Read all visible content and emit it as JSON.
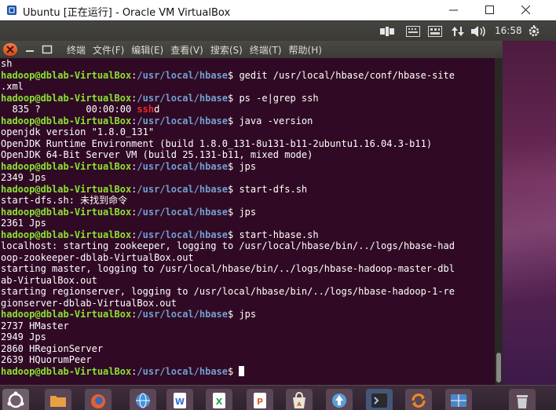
{
  "window": {
    "title": "Ubuntu [正在运行] - Oracle VM VirtualBox"
  },
  "panel": {
    "clock": "16:58",
    "icons": [
      "keyboard-layout-icon",
      "input-method-icon",
      "input-method-grid-icon",
      "network-updown-icon",
      "volume-icon",
      "settings-gear-icon"
    ]
  },
  "terminal": {
    "menu": [
      "终端",
      "文件(F)",
      "编辑(E)",
      "查看(V)",
      "搜索(S)",
      "终端(T)",
      "帮助(H)"
    ],
    "prompt_user": "hadoop@dblab-VirtualBox",
    "prompt_path": "/usr/local/hbase",
    "prompt_sep": ":",
    "prompt_end": "$ ",
    "lines": [
      {
        "t": "out",
        "text": "sh"
      },
      {
        "t": "prompt",
        "cmd": "gedit /usr/local/hbase/conf/hbase-site"
      },
      {
        "t": "out",
        "text": ".xml"
      },
      {
        "t": "prompt",
        "cmd": "ps -e|grep ssh"
      },
      {
        "t": "psline",
        "pre": "  835 ?        00:00:00 ",
        "hl": "ssh",
        "post": "d"
      },
      {
        "t": "prompt",
        "cmd": "java -version"
      },
      {
        "t": "out",
        "text": "openjdk version \"1.8.0_131\""
      },
      {
        "t": "out",
        "text": "OpenJDK Runtime Environment (build 1.8.0_131-8u131-b11-2ubuntu1.16.04.3-b11)"
      },
      {
        "t": "out",
        "text": "OpenJDK 64-Bit Server VM (build 25.131-b11, mixed mode)"
      },
      {
        "t": "prompt",
        "cmd": "jps"
      },
      {
        "t": "out",
        "text": "2349 Jps"
      },
      {
        "t": "prompt",
        "cmd": "start-dfs.sh"
      },
      {
        "t": "out",
        "text": "start-dfs.sh: 未找到命令"
      },
      {
        "t": "prompt",
        "cmd": "jps"
      },
      {
        "t": "out",
        "text": "2361 Jps"
      },
      {
        "t": "prompt",
        "cmd": "start-hbase.sh"
      },
      {
        "t": "out",
        "text": "localhost: starting zookeeper, logging to /usr/local/hbase/bin/../logs/hbase-had"
      },
      {
        "t": "out",
        "text": "oop-zookeeper-dblab-VirtualBox.out"
      },
      {
        "t": "out",
        "text": "starting master, logging to /usr/local/hbase/bin/../logs/hbase-hadoop-master-dbl"
      },
      {
        "t": "out",
        "text": "ab-VirtualBox.out"
      },
      {
        "t": "out",
        "text": "starting regionserver, logging to /usr/local/hbase/bin/../logs/hbase-hadoop-1-re"
      },
      {
        "t": "out",
        "text": "gionserver-dblab-VirtualBox.out"
      },
      {
        "t": "prompt",
        "cmd": "jps"
      },
      {
        "t": "out",
        "text": "2737 HMaster"
      },
      {
        "t": "out",
        "text": "2949 Jps"
      },
      {
        "t": "out",
        "text": "2860 HRegionServer"
      },
      {
        "t": "out",
        "text": "2639 HQuorumPeer"
      },
      {
        "t": "prompt",
        "cmd": "",
        "cursor": true
      }
    ]
  },
  "dock": {
    "items": [
      {
        "name": "ubuntu-dash-icon",
        "bg": "#6d5e6a",
        "fg": "#ffffff"
      },
      {
        "name": "files-folder-icon",
        "bg": "#5a4655",
        "fg": "#e8a040"
      },
      {
        "name": "firefox-icon",
        "bg": "#5a4655",
        "fg": "#e8602c"
      },
      {
        "name": "browser-globe-icon",
        "bg": "#5a4655",
        "fg": "#4a90d9"
      },
      {
        "name": "wps-writer-icon",
        "bg": "#5a4655",
        "fg": "#2e6fd8"
      },
      {
        "name": "wps-spreadsheet-icon",
        "bg": "#5a4655",
        "fg": "#2a9d4a"
      },
      {
        "name": "wps-presentation-icon",
        "bg": "#5a4655",
        "fg": "#e2632e"
      },
      {
        "name": "software-center-bag-icon",
        "bg": "#5a4655",
        "fg": "#e9e3d6"
      },
      {
        "name": "update-manager-icon",
        "bg": "#5a4655",
        "fg": "#5aa0d8"
      },
      {
        "name": "terminal-icon",
        "bg": "#46567a",
        "fg": "#9fc6ff"
      },
      {
        "name": "sync-refresh-icon",
        "bg": "#5a4655",
        "fg": "#f08a24"
      },
      {
        "name": "workspace-switcher-icon",
        "bg": "#5a4655",
        "fg": "#4b86c9"
      },
      {
        "name": "trash-icon",
        "bg": "#5a4655",
        "fg": "#cfcfcf"
      }
    ]
  },
  "colors": {
    "terminal_bg": "#300a24",
    "prompt_user": "#8ae234",
    "prompt_path": "#729fcf",
    "highlight": "#ef2929",
    "close_button": "#dd4814"
  }
}
